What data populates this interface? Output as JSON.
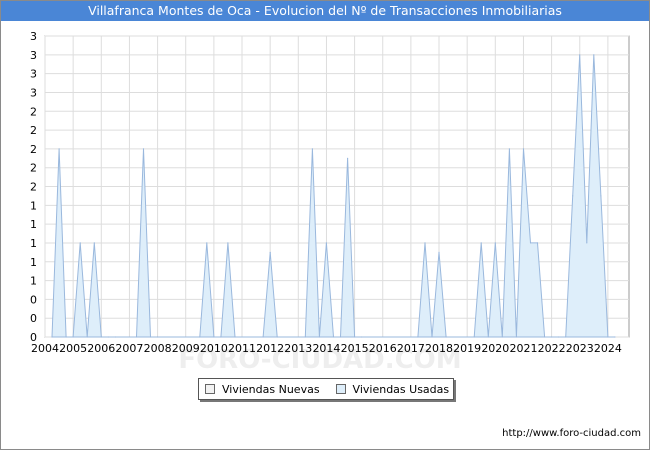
{
  "title": "Villafranca Montes de Oca - Evolucion del Nº de Transacciones Inmobiliarias",
  "watermark": "FORO-CIUDAD.COM",
  "credit": "http://www.foro-ciudad.com",
  "colors": {
    "title_bg": "#4a86d6",
    "series_fill": "#deeefa",
    "series_stroke": "#9ab8dd",
    "nuevas_swatch": "#f2f2f2",
    "grid": "#dddddd"
  },
  "legend": {
    "nuevas": "Viviendas Nuevas",
    "usadas": "Viviendas Usadas"
  },
  "chart_data": {
    "type": "area",
    "title": "Villafranca Montes de Oca - Evolucion del Nº de Transacciones Inmobiliarias",
    "xlabel": "",
    "ylabel": "",
    "xlim": [
      2004,
      2024.75
    ],
    "ylim": [
      0,
      3.2
    ],
    "y_ticks": [
      0,
      0.2,
      0.4,
      0.6,
      0.8,
      1.0,
      1.2,
      1.4,
      1.6,
      1.8,
      2.0,
      2.2,
      2.4,
      2.6,
      2.8,
      3.0,
      3.2
    ],
    "y_tick_labels": [
      "0",
      "0",
      "0",
      "1",
      "1",
      "1",
      "1",
      "1",
      "2",
      "2",
      "2",
      "2",
      "2",
      "3",
      "3",
      "3",
      "3"
    ],
    "x_ticks": [
      2004,
      2005,
      2006,
      2007,
      2008,
      2009,
      2010,
      2011,
      2012,
      2013,
      2014,
      2015,
      2016,
      2017,
      2018,
      2019,
      2020,
      2021,
      2022,
      2023,
      2024
    ],
    "x_tick_labels": [
      "2004",
      "2005",
      "2006",
      "2007",
      "2008",
      "2009",
      "2010",
      "2011",
      "2012",
      "2013",
      "2014",
      "2015",
      "2016",
      "2017",
      "2018",
      "2019",
      "2020",
      "2021",
      "2022",
      "2023",
      "2024"
    ],
    "grid": true,
    "legend_position": "bottom",
    "series": [
      {
        "name": "Viviendas Nuevas",
        "x": [],
        "y": []
      },
      {
        "name": "Viviendas Usadas",
        "x": [
          2004.25,
          2004.5,
          2004.75,
          2005.0,
          2005.25,
          2005.5,
          2005.75,
          2006.0,
          2006.25,
          2006.5,
          2007.25,
          2007.5,
          2007.75,
          2008.0,
          2009.5,
          2009.75,
          2010.0,
          2010.25,
          2010.5,
          2010.75,
          2011.75,
          2012.0,
          2012.25,
          2013.25,
          2013.5,
          2013.75,
          2014.0,
          2014.25,
          2014.5,
          2014.75,
          2015.0,
          2015.25,
          2017.25,
          2017.5,
          2017.75,
          2018.0,
          2018.25,
          2019.25,
          2019.5,
          2019.75,
          2020.0,
          2020.25,
          2020.5,
          2020.75,
          2021.0,
          2021.25,
          2021.5,
          2021.75,
          2022.0,
          2022.25,
          2022.5,
          2022.75,
          2023.0,
          2023.25,
          2023.5,
          2023.75,
          2024.0,
          2024.25
        ],
        "y": [
          0,
          2,
          0,
          0,
          1,
          0,
          1,
          0,
          0,
          0,
          0,
          2,
          0,
          0,
          0,
          1,
          0,
          0,
          1,
          0,
          0,
          0.9,
          0,
          0,
          2,
          0,
          1,
          0,
          0,
          1.9,
          0,
          0,
          0,
          1,
          0,
          0.9,
          0,
          0,
          1,
          0,
          1,
          0,
          2,
          0,
          2,
          1,
          1,
          0,
          0,
          0,
          0,
          1.5,
          3,
          1,
          3,
          1.5,
          0,
          0
        ]
      }
    ]
  }
}
